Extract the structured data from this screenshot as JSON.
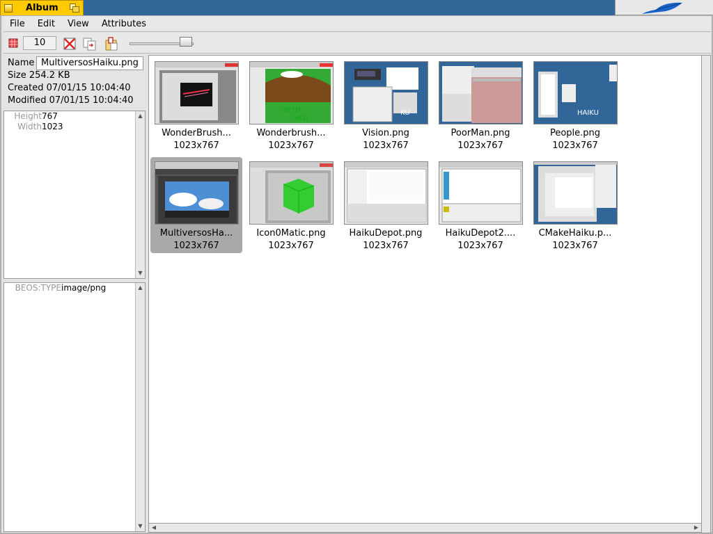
{
  "window": {
    "title": "Album"
  },
  "menu": [
    "File",
    "Edit",
    "View",
    "Attributes"
  ],
  "toolbar": {
    "zoom_value": "10"
  },
  "info": {
    "name_label": "Name",
    "name_value": "MultiversosHaiku.png",
    "size": "Size 254.2 KB",
    "created": "Created 07/01/15 10:04:40",
    "modified": "Modified 07/01/15 10:04:40"
  },
  "image_attrs": [
    {
      "key": "Height",
      "value": "767"
    },
    {
      "key": "Width",
      "value": "1023"
    }
  ],
  "file_attrs": [
    {
      "key": "BEOS:TYPE",
      "value": "image/png"
    }
  ],
  "thumbnails": [
    {
      "name": "WonderBrush...",
      "dims": "1023x767",
      "selected": false
    },
    {
      "name": "Wonderbrush...",
      "dims": "1023x767",
      "selected": false
    },
    {
      "name": "Vision.png",
      "dims": "1023x767",
      "selected": false
    },
    {
      "name": "PoorMan.png",
      "dims": "1023x767",
      "selected": false
    },
    {
      "name": "People.png",
      "dims": "1023x767",
      "selected": false
    },
    {
      "name": "MultiversosHa...",
      "dims": "1023x767",
      "selected": true
    },
    {
      "name": "Icon0Matic.png",
      "dims": "1023x767",
      "selected": false
    },
    {
      "name": "HaikuDepot.png",
      "dims": "1023x767",
      "selected": false
    },
    {
      "name": "HaikuDepot2....",
      "dims": "1023x767",
      "selected": false
    },
    {
      "name": "CMakeHaiku.p...",
      "dims": "1023x767",
      "selected": false
    }
  ],
  "colors": {
    "desktop": "#336698",
    "tab": "#ffcb00",
    "selection": "#a9a9a9"
  }
}
